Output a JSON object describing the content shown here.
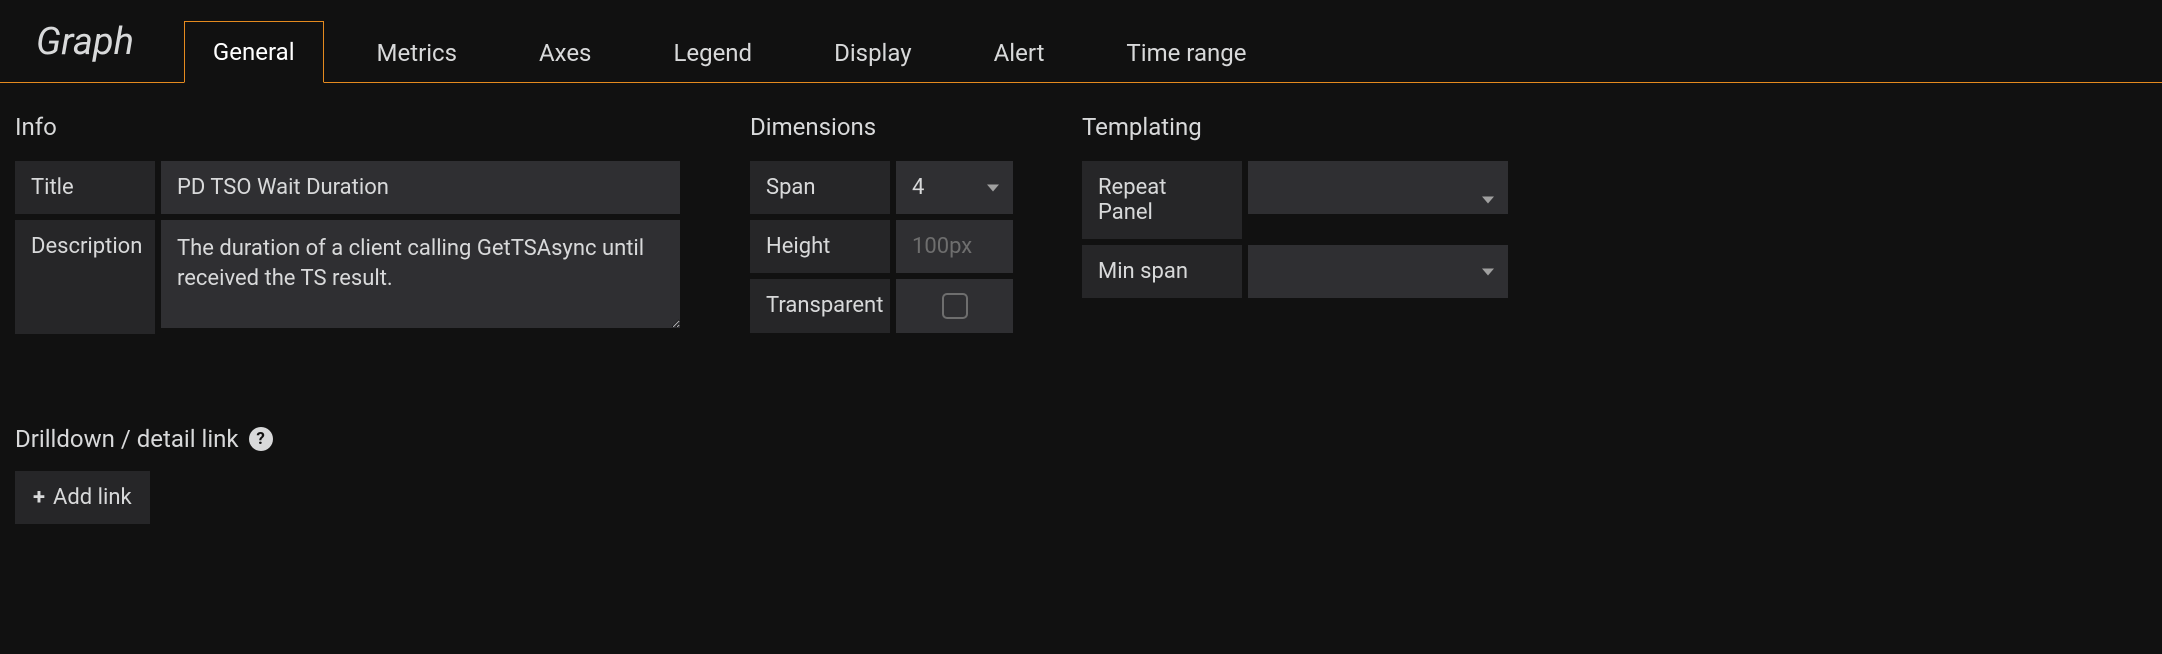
{
  "panel_type": "Graph",
  "tabs": {
    "general": "General",
    "metrics": "Metrics",
    "axes": "Axes",
    "legend": "Legend",
    "display": "Display",
    "alert": "Alert",
    "time_range": "Time range"
  },
  "sections": {
    "info": {
      "title": "Info",
      "title_label": "Title",
      "title_value": "PD TSO Wait Duration",
      "description_label": "Description",
      "description_value": "The duration of a client calling GetTSAsync until received the TS result."
    },
    "dimensions": {
      "title": "Dimensions",
      "span_label": "Span",
      "span_value": "4",
      "height_label": "Height",
      "height_placeholder": "100px",
      "transparent_label": "Transparent"
    },
    "templating": {
      "title": "Templating",
      "repeat_panel_label": "Repeat Panel",
      "min_span_label": "Min span"
    }
  },
  "drilldown": {
    "title": "Drilldown / detail link",
    "add_link_label": "Add link"
  }
}
